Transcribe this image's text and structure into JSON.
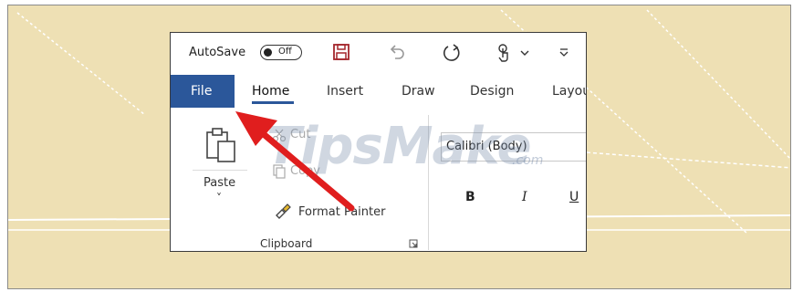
{
  "quick_access": {
    "autosave_label": "AutoSave",
    "autosave_state": "Off",
    "icons": [
      "save-icon",
      "undo-icon",
      "redo-icon",
      "touch-mode-icon",
      "customize-qat-icon"
    ]
  },
  "tabs": [
    {
      "label": "File"
    },
    {
      "label": "Home"
    },
    {
      "label": "Insert"
    },
    {
      "label": "Draw"
    },
    {
      "label": "Design"
    },
    {
      "label": "Layou"
    }
  ],
  "active_tab": "Home",
  "clipboard": {
    "paste_label": "Paste",
    "paste_dropdown": "˅",
    "cut_label": "Cut",
    "copy_label": "Copy",
    "format_painter_label": "Format Painter",
    "group_label": "Clipboard"
  },
  "font": {
    "font_name": "Calibri (Body)",
    "bold": "B",
    "italic": "I",
    "underline": "U"
  },
  "watermark": {
    "text": "TipsMake",
    "suffix": ".com"
  },
  "colors": {
    "file_tab": "#2b579a",
    "save_icon": "#a4262c",
    "arrow": "#e01e1e",
    "background": "#eee0b4"
  }
}
